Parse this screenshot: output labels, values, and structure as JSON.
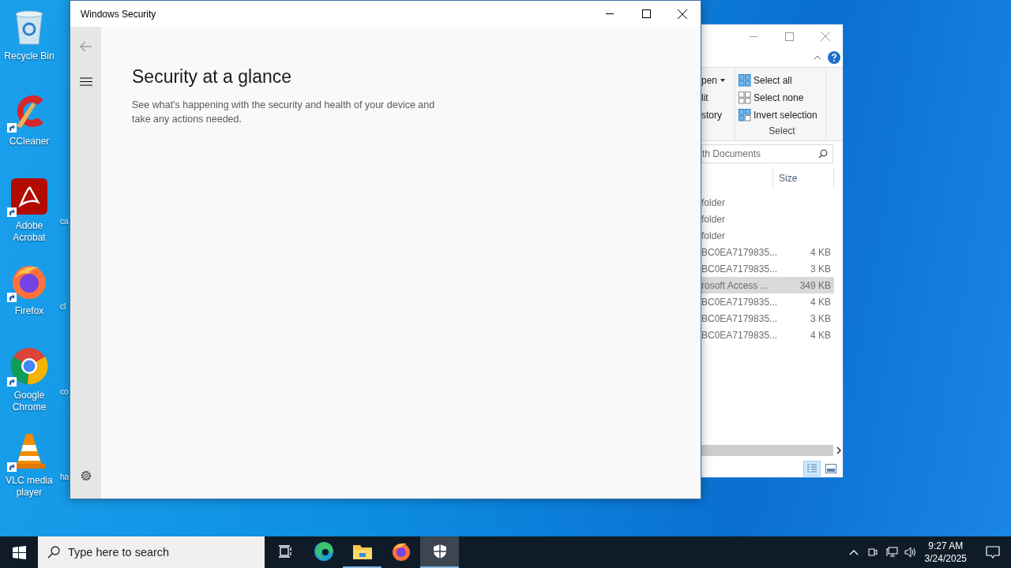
{
  "desktop_icons": [
    {
      "kind": "recycle",
      "label": "Recycle Bin",
      "shortcut": false
    },
    {
      "kind": "ccleaner",
      "label": "CCleaner",
      "shortcut": true
    },
    {
      "kind": "acrobat",
      "label": "Adobe Acrobat",
      "shortcut": true
    },
    {
      "kind": "firefox",
      "label": "Firefox",
      "shortcut": true
    },
    {
      "kind": "chrome",
      "label": "Google Chrome",
      "shortcut": true
    },
    {
      "kind": "vlc",
      "label": "VLC media player",
      "shortcut": true
    }
  ],
  "hidden_icon_labels": [
    "ca",
    "cl",
    "co",
    "ha"
  ],
  "security_window": {
    "title": "Windows Security",
    "heading": "Security at a glance",
    "description": "See what's happening with the security and health of your device and take any actions needed."
  },
  "explorer": {
    "ribbon_left": [
      {
        "label": "pen",
        "dropdown": true
      },
      {
        "label": "lit",
        "dropdown": false
      },
      {
        "label": "story",
        "dropdown": false
      }
    ],
    "select_actions": [
      {
        "kind": "all",
        "label": "Select all"
      },
      {
        "kind": "none",
        "label": "Select none"
      },
      {
        "kind": "invert",
        "label": "Invert selection"
      }
    ],
    "select_group": "Select",
    "search_placeholder": "th Documents",
    "size_column": "Size",
    "rows": [
      {
        "type": "folder",
        "selected": false
      },
      {
        "type": "folder",
        "selected": false
      },
      {
        "type": "folder",
        "selected": false
      },
      {
        "type": "BC0EA7179835...",
        "size": "4 KB",
        "selected": false
      },
      {
        "type": "BC0EA7179835...",
        "size": "3 KB",
        "selected": false
      },
      {
        "type": "rosoft Access ...",
        "size": "349 KB",
        "selected": true
      },
      {
        "type": "BC0EA7179835...",
        "size": "4 KB",
        "selected": false
      },
      {
        "type": "BC0EA7179835...",
        "size": "3 KB",
        "selected": false
      },
      {
        "type": "BC0EA7179835...",
        "size": "4 KB",
        "selected": false
      }
    ]
  },
  "taskbar": {
    "search_placeholder": "Type here to search",
    "apps": [
      {
        "kind": "edge",
        "open": false,
        "selected": false
      },
      {
        "kind": "explorer",
        "open": true,
        "selected": false
      },
      {
        "kind": "firefox",
        "open": false,
        "selected": false
      },
      {
        "kind": "security",
        "open": true,
        "selected": true
      }
    ],
    "time": "9:27 AM",
    "date": "3/24/2025"
  }
}
